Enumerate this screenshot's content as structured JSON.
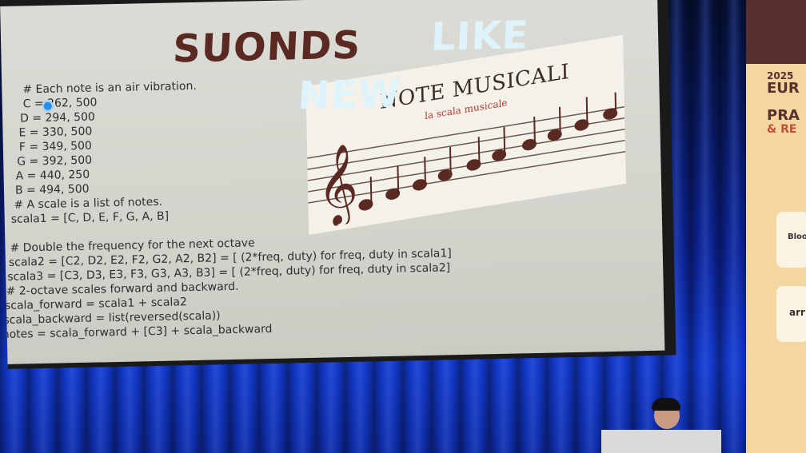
{
  "slide": {
    "title": {
      "part1": "SUONDS",
      "part2": "LIKE",
      "part3": "NEW"
    },
    "code_lines": [
      "# Each note is an air vibration.",
      "C = 262, 500",
      "D = 294, 500",
      "E = 330, 500",
      "F = 349, 500",
      "G = 392, 500",
      "A = 440, 250",
      "B = 494, 500",
      "# A scale is a list of notes.",
      "scala1 = [C, D, E, F, G, A, B]",
      "# Double the frequency for the next octave",
      "scala2 = [C2, D2, E2, F2, G2, A2, B2] = [ (2*freq, duty) for freq, duty in scala1]",
      "scala3 = [C3, D3, E3, F3, G3, A3, B3] = [ (2*freq, duty) for freq, duty in scala2]",
      "# 2-octave scales forward and backward.",
      "scala_forward = scala1 + scala2",
      "scala_backward = list(reversed(scala))",
      "notes = scala_forward + [C3] + scala_backward"
    ],
    "music_card": {
      "title": "NOTE MUSICALI",
      "subtitle": "la scala musicale"
    }
  },
  "banner": {
    "year": "2025",
    "line1": "EUR",
    "line2": "PRA",
    "line3": "& RE",
    "sponsor1": "Bloo",
    "sponsor2": "arr"
  },
  "colors": {
    "title_dark": "#5a2a22",
    "title_light": "#dff3fb",
    "curtain": "#1238c8",
    "banner": "#f4d7a0"
  }
}
